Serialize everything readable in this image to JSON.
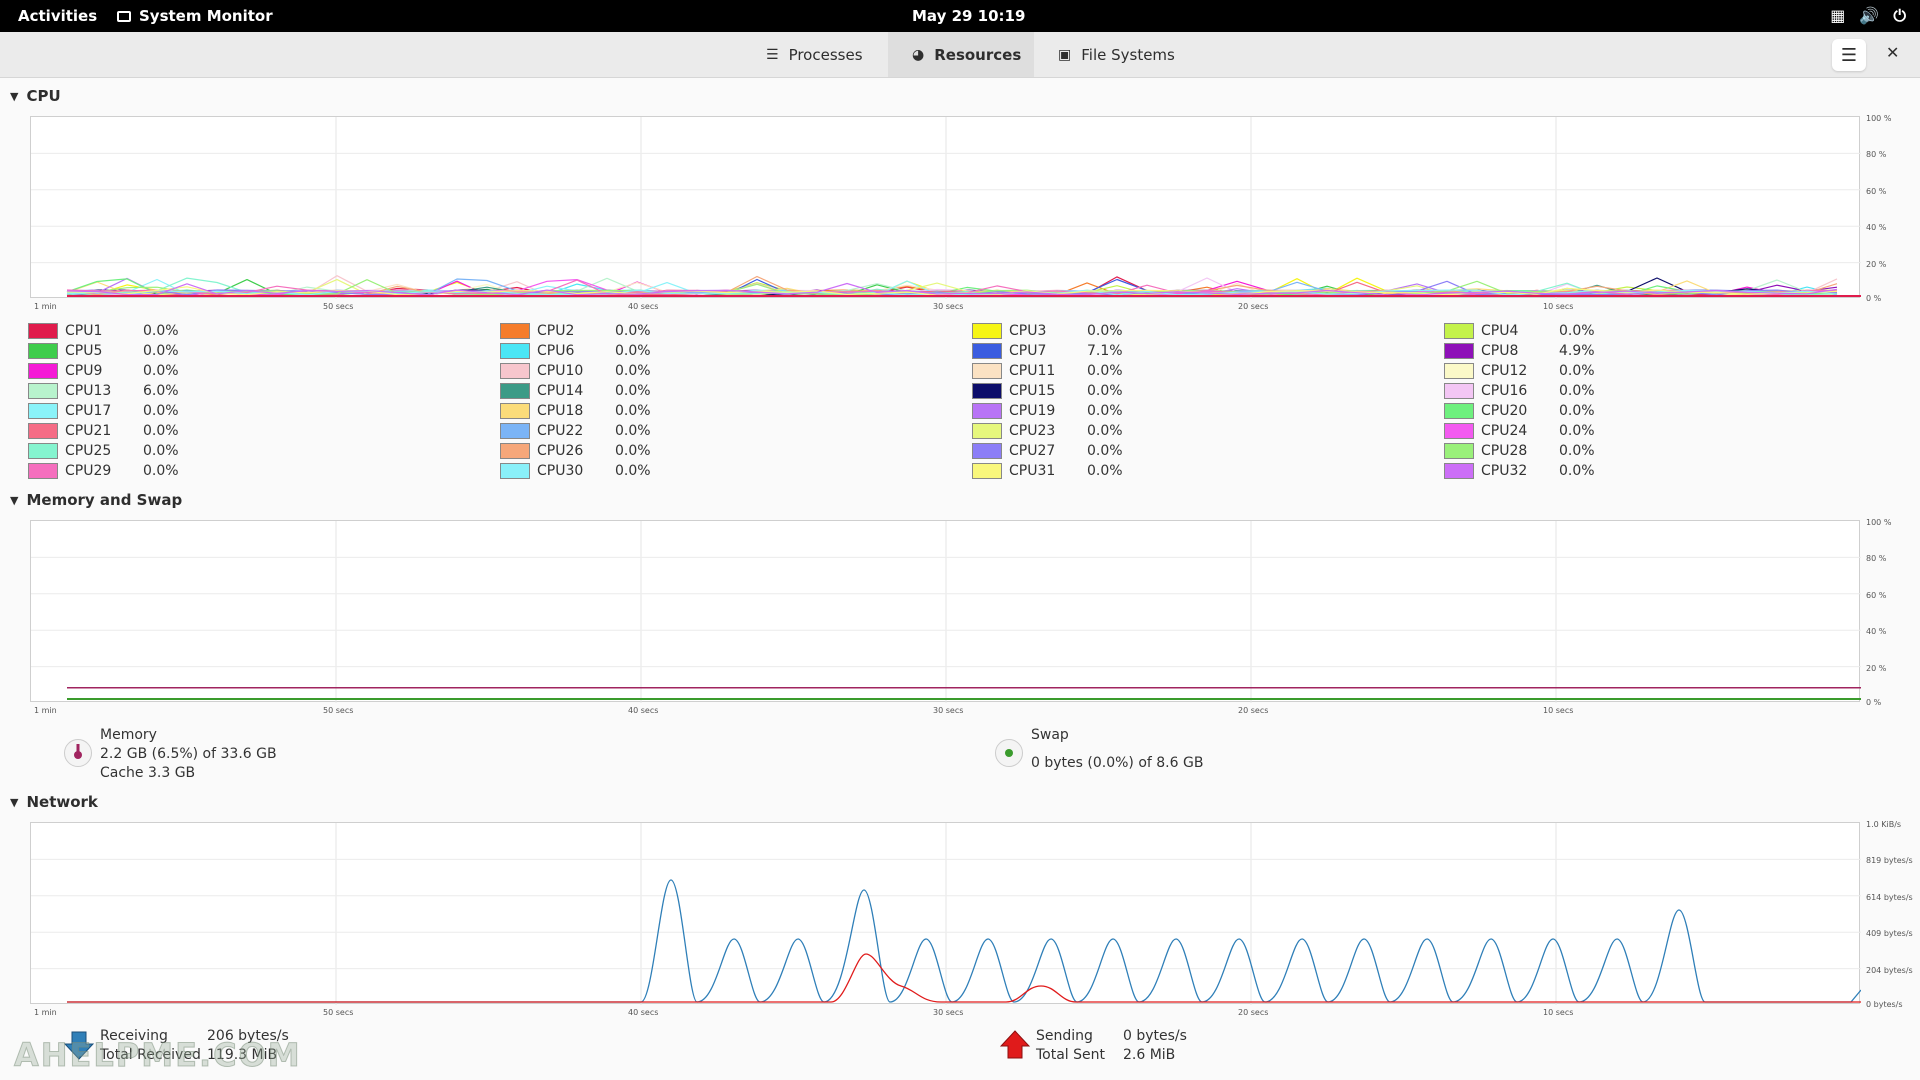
{
  "topbar": {
    "activities": "Activities",
    "app_name": "System Monitor",
    "clock": "May 29  10:19"
  },
  "tabs": [
    {
      "label": "Processes",
      "icon": "list-icon",
      "active": false
    },
    {
      "label": "Resources",
      "icon": "gauge-icon",
      "active": true
    },
    {
      "label": "File Systems",
      "icon": "disk-icon",
      "active": false
    }
  ],
  "sections": {
    "cpu": "CPU",
    "memory": "Memory and Swap",
    "network": "Network"
  },
  "x_axis_labels": [
    "1 min",
    "50 secs",
    "40 secs",
    "30 secs",
    "20 secs",
    "10 secs"
  ],
  "cpu_y_labels": [
    "100 %",
    "80 %",
    "60 %",
    "40 %",
    "20 %",
    "0 %"
  ],
  "mem_y_labels": [
    "100 %",
    "80 %",
    "60 %",
    "40 %",
    "20 %",
    "0 %"
  ],
  "net_y_labels": [
    "1.0 KiB/s",
    "819 bytes/s",
    "614 bytes/s",
    "409 bytes/s",
    "204 bytes/s",
    "0 bytes/s"
  ],
  "cpus": [
    {
      "name": "CPU1",
      "value": "0.0%",
      "color": "#e01b4c"
    },
    {
      "name": "CPU2",
      "value": "0.0%",
      "color": "#f57c2b"
    },
    {
      "name": "CPU3",
      "value": "0.0%",
      "color": "#f6f514"
    },
    {
      "name": "CPU4",
      "value": "0.0%",
      "color": "#c4f24a"
    },
    {
      "name": "CPU5",
      "value": "0.0%",
      "color": "#3fcd4c"
    },
    {
      "name": "CPU6",
      "value": "0.0%",
      "color": "#4ae6f5"
    },
    {
      "name": "CPU7",
      "value": "7.1%",
      "color": "#3a5ce0"
    },
    {
      "name": "CPU8",
      "value": "4.9%",
      "color": "#8e10b8"
    },
    {
      "name": "CPU9",
      "value": "0.0%",
      "color": "#f51ad6"
    },
    {
      "name": "CPU10",
      "value": "0.0%",
      "color": "#f7c6cd"
    },
    {
      "name": "CPU11",
      "value": "0.0%",
      "color": "#fbe2c3"
    },
    {
      "name": "CPU12",
      "value": "0.0%",
      "color": "#fbf9c8"
    },
    {
      "name": "CPU13",
      "value": "6.0%",
      "color": "#b8f3cd"
    },
    {
      "name": "CPU14",
      "value": "0.0%",
      "color": "#3c9b87"
    },
    {
      "name": "CPU15",
      "value": "0.0%",
      "color": "#0c0d6a"
    },
    {
      "name": "CPU16",
      "value": "0.0%",
      "color": "#f3c6f4"
    },
    {
      "name": "CPU17",
      "value": "0.0%",
      "color": "#8af3f9"
    },
    {
      "name": "CPU18",
      "value": "0.0%",
      "color": "#fbdc7a"
    },
    {
      "name": "CPU19",
      "value": "0.0%",
      "color": "#b874f6"
    },
    {
      "name": "CPU20",
      "value": "0.0%",
      "color": "#6ef07e"
    },
    {
      "name": "CPU21",
      "value": "0.0%",
      "color": "#f56c86"
    },
    {
      "name": "CPU22",
      "value": "0.0%",
      "color": "#7bb4f6"
    },
    {
      "name": "CPU23",
      "value": "0.0%",
      "color": "#e6f77d"
    },
    {
      "name": "CPU24",
      "value": "0.0%",
      "color": "#f35af0"
    },
    {
      "name": "CPU25",
      "value": "0.0%",
      "color": "#85f4cf"
    },
    {
      "name": "CPU26",
      "value": "0.0%",
      "color": "#f6a77a"
    },
    {
      "name": "CPU27",
      "value": "0.0%",
      "color": "#8c7ef7"
    },
    {
      "name": "CPU28",
      "value": "0.0%",
      "color": "#9af07a"
    },
    {
      "name": "CPU29",
      "value": "0.0%",
      "color": "#f56fbe"
    },
    {
      "name": "CPU30",
      "value": "0.0%",
      "color": "#8af0f9"
    },
    {
      "name": "CPU31",
      "value": "0.0%",
      "color": "#f9f77c"
    },
    {
      "name": "CPU32",
      "value": "0.0%",
      "color": "#cc6ef7"
    }
  ],
  "memory": {
    "label": "Memory",
    "usage": "2.2 GB (6.5%) of 33.6 GB",
    "cache": "Cache 3.3 GB",
    "percent": 6.5,
    "color": "#a0245f"
  },
  "swap": {
    "label": "Swap",
    "usage": "0 bytes (0.0%) of 8.6 GB",
    "percent": 0.0,
    "color": "#3a9b2c"
  },
  "network": {
    "receiving_label": "Receiving",
    "receiving_value": "206 bytes/s",
    "total_received_label": "Total Received",
    "total_received_value": "119.3 MiB",
    "sending_label": "Sending",
    "sending_value": "0 bytes/s",
    "total_sent_label": "Total Sent",
    "total_sent_value": "2.6 MiB",
    "receive_color": "#2f7fb8",
    "send_color": "#e01b1b"
  },
  "watermark": "AHELPME.COM"
}
